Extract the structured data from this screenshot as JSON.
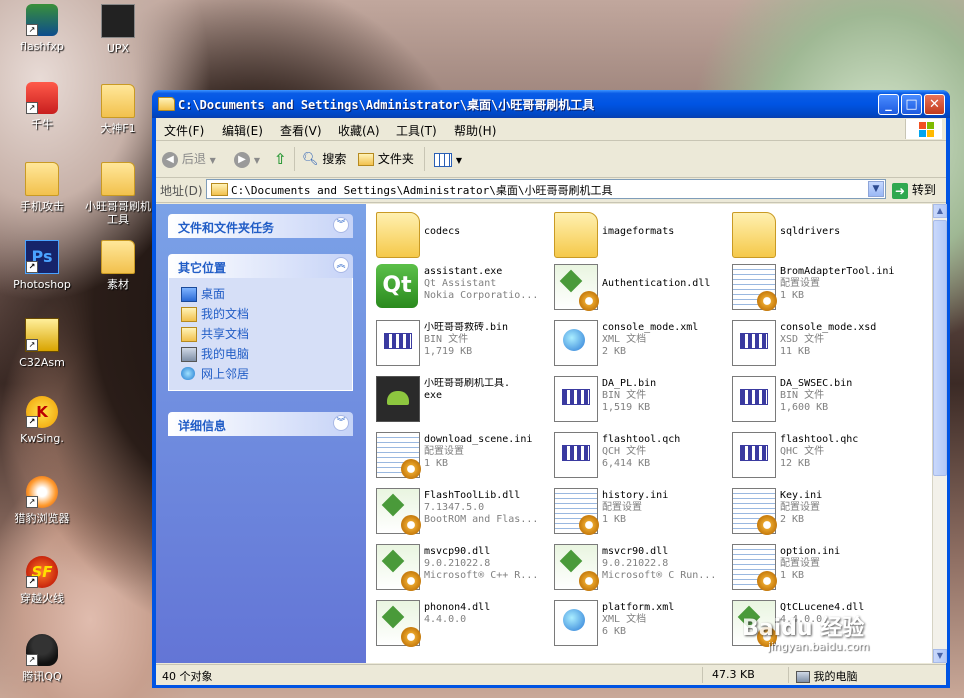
{
  "desktop": {
    "icons": [
      {
        "label": "flashfxp"
      },
      {
        "label": "UPX"
      },
      {
        "label": "千牛"
      },
      {
        "label": "大神F1"
      },
      {
        "label": "手机攻击"
      },
      {
        "label": "小旺哥哥刷机工具"
      },
      {
        "label": "Photoshop"
      },
      {
        "label": "素材"
      },
      {
        "label": "C32Asm"
      },
      {
        "label": "KwSing."
      },
      {
        "label": "猎豹浏览器"
      },
      {
        "label": "穿越火线"
      },
      {
        "label": "腾讯QQ"
      }
    ]
  },
  "window": {
    "title": "C:\\Documents and Settings\\Administrator\\桌面\\小旺哥哥刷机工具",
    "controls": {
      "minimize": "_",
      "maximize": "□",
      "close": "✕"
    }
  },
  "menubar": {
    "items": [
      "文件(F)",
      "编辑(E)",
      "查看(V)",
      "收藏(A)",
      "工具(T)",
      "帮助(H)"
    ]
  },
  "toolbar": {
    "back": "后退",
    "search": "搜索",
    "folders": "文件夹"
  },
  "address": {
    "label": "地址(D)",
    "value": "C:\\Documents and Settings\\Administrator\\桌面\\小旺哥哥刷机工具",
    "go": "转到"
  },
  "taskpane": {
    "file_tasks": {
      "title": "文件和文件夹任务"
    },
    "other_places": {
      "title": "其它位置",
      "items": [
        "桌面",
        "我的文档",
        "共享文档",
        "我的电脑",
        "网上邻居"
      ]
    },
    "details": {
      "title": "详细信息"
    }
  },
  "files": [
    {
      "name": "codecs",
      "line2": "",
      "line3": "",
      "icon": "folder-icon"
    },
    {
      "name": "imageformats",
      "line2": "",
      "line3": "",
      "icon": "folder-icon"
    },
    {
      "name": "sqldrivers",
      "line2": "",
      "line3": "",
      "icon": "folder-icon"
    },
    {
      "name": "assistant.exe",
      "line2": "Qt Assistant",
      "line3": "Nokia Corporatio...",
      "icon": "qt-app-icon"
    },
    {
      "name": "Authentication.dll",
      "line2": "",
      "line3": "",
      "icon": "dll-icon"
    },
    {
      "name": "BromAdapterTool.ini",
      "line2": "配置设置",
      "line3": "1 KB",
      "icon": "ini-icon"
    },
    {
      "name": "小旺哥哥救砖.bin",
      "line2": "BIN 文件",
      "line3": "1,719 KB",
      "icon": "bin-icon"
    },
    {
      "name": "console_mode.xml",
      "line2": "XML 文档",
      "line3": "2 KB",
      "icon": "xml-icon"
    },
    {
      "name": "console_mode.xsd",
      "line2": "XSD 文件",
      "line3": "11 KB",
      "icon": "bin-icon"
    },
    {
      "name": "小旺哥哥刷机工具.",
      "line2": "exe",
      "line3": "",
      "icon": "android-app-icon"
    },
    {
      "name": "DA_PL.bin",
      "line2": "BIN 文件",
      "line3": "1,519 KB",
      "icon": "bin-icon"
    },
    {
      "name": "DA_SWSEC.bin",
      "line2": "BIN 文件",
      "line3": "1,600 KB",
      "icon": "bin-icon"
    },
    {
      "name": "download_scene.ini",
      "line2": "配置设置",
      "line3": "1 KB",
      "icon": "ini-icon"
    },
    {
      "name": "flashtool.qch",
      "line2": "QCH 文件",
      "line3": "6,414 KB",
      "icon": "bin-icon"
    },
    {
      "name": "flashtool.qhc",
      "line2": "QHC 文件",
      "line3": "12 KB",
      "icon": "bin-icon"
    },
    {
      "name": "FlashToolLib.dll",
      "line2": "7.1347.5.0",
      "line3": "BootROM and Flas...",
      "icon": "dll-icon"
    },
    {
      "name": "history.ini",
      "line2": "配置设置",
      "line3": "1 KB",
      "icon": "ini-icon"
    },
    {
      "name": "Key.ini",
      "line2": "配置设置",
      "line3": "2 KB",
      "icon": "ini-icon"
    },
    {
      "name": "msvcp90.dll",
      "line2": "9.0.21022.8",
      "line3": "Microsoft® C++ R...",
      "icon": "dll-icon"
    },
    {
      "name": "msvcr90.dll",
      "line2": "9.0.21022.8",
      "line3": "Microsoft® C Run...",
      "icon": "dll-icon"
    },
    {
      "name": "option.ini",
      "line2": "配置设置",
      "line3": "1 KB",
      "icon": "ini-icon"
    },
    {
      "name": "phonon4.dll",
      "line2": "4.4.0.0",
      "line3": "",
      "icon": "dll-icon"
    },
    {
      "name": "platform.xml",
      "line2": "XML 文档",
      "line3": "6 KB",
      "icon": "xml-icon"
    },
    {
      "name": "QtCLucene4.dll",
      "line2": "4.4.0.0",
      "line3": "",
      "icon": "dll-icon"
    }
  ],
  "statusbar": {
    "count": "40 个对象",
    "size": "47.3 KB",
    "location": "我的电脑"
  },
  "watermark": {
    "brand": "Baidu 经验",
    "url": "jingyan.baidu.com"
  }
}
